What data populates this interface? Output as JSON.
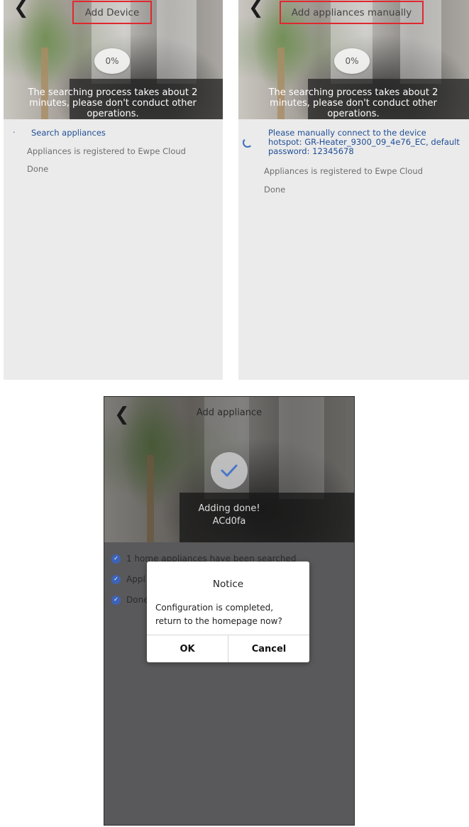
{
  "screen1": {
    "title": "Add Device",
    "percent": "0%",
    "hero_text": "The searching process takes about 2 minutes, please don't conduct other operations.",
    "steps": [
      {
        "label": "Search appliances",
        "state": "active"
      },
      {
        "label": "Appliances is registered to Ewpe Cloud",
        "state": "pending"
      },
      {
        "label": "Done",
        "state": "pending"
      }
    ]
  },
  "screen2": {
    "title": "Add appliances manually",
    "percent": "0%",
    "hero_text": "The searching process takes about 2 minutes, please don't conduct other operations.",
    "steps": [
      {
        "label": "Please manually connect to the device hotspot: GR-Heater_9300_09_4e76_EC, default password: 12345678",
        "state": "active"
      },
      {
        "label": "Appliances is registered to Ewpe Cloud",
        "state": "pending"
      },
      {
        "label": "Done",
        "state": "pending"
      }
    ]
  },
  "screen3": {
    "title": "Add appliance",
    "status_line1": "Adding done!",
    "status_line2": "ACd0fa",
    "steps": [
      {
        "label": "1 home appliances have been searched"
      },
      {
        "label": "Appl"
      },
      {
        "label": "Done"
      }
    ],
    "dialog": {
      "title": "Notice",
      "message": "Configuration is completed, return to the homepage now?",
      "ok_label": "OK",
      "cancel_label": "Cancel"
    }
  },
  "colors": {
    "highlight_box": "#e0282d",
    "active_step": "#1f4e97",
    "check_blue": "#3d63b8"
  }
}
